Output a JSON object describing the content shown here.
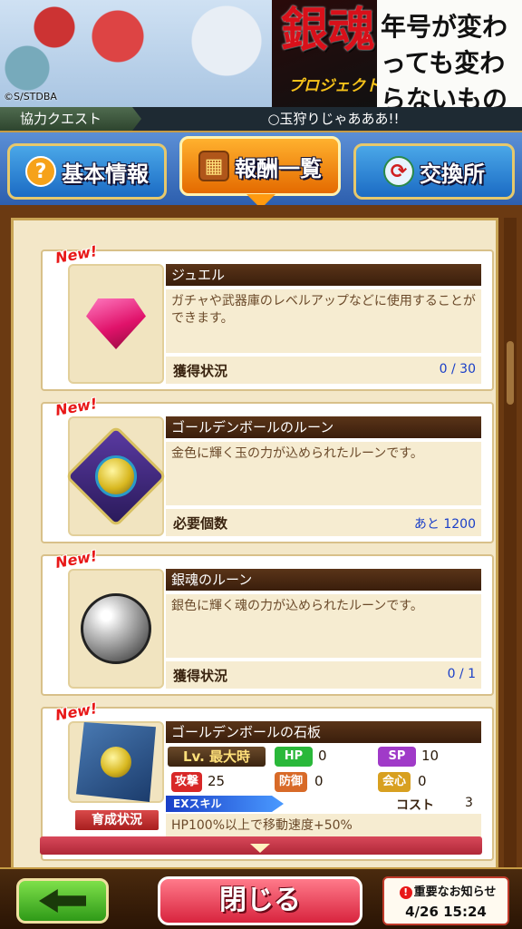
{
  "banner": {
    "logo": "銀魂",
    "logo_sub": "プロジェクト",
    "slogan": "年号が変わっても変わらないものがある",
    "copyright": "©S/STDBA"
  },
  "quest": {
    "type": "協力クエスト",
    "name": "○玉狩りじゃあああ!!"
  },
  "tabs": {
    "basic": {
      "label": "基本情報",
      "icon": "?"
    },
    "reward": {
      "label": "報酬一覧",
      "icon": "▦"
    },
    "exchange": {
      "label": "交換所",
      "icon": "⟳"
    }
  },
  "cards": [
    {
      "new": "New!",
      "title": "ジュエル",
      "desc": "ガチャや武器庫のレベルアップなどに使用することができます。",
      "status_label": "獲得状況",
      "status_value": "0 / 30"
    },
    {
      "new": "New!",
      "title": "ゴールデンボールのルーン",
      "desc": "金色に輝く玉の力が込められたルーンです。",
      "status_label": "必要個数",
      "status_value": "あと 1200"
    },
    {
      "new": "New!",
      "title": "銀魂のルーン",
      "desc": "銀色に輝く魂の力が込められたルーンです。",
      "status_label": "獲得状況",
      "status_value": "0 / 1"
    },
    {
      "new": "New!",
      "title": "ゴールデンボールの石板",
      "grow_label": "育成状況",
      "lv_label": "Lv. 最大時",
      "stats": {
        "hp_label": "HP",
        "hp_value": "0",
        "sp_label": "SP",
        "sp_value": "10",
        "atk_label": "攻撃",
        "atk_value": "25",
        "def_label": "防御",
        "def_value": "0",
        "crit_label": "会心",
        "crit_value": "0"
      },
      "ex_label": "EXスキル",
      "cost_label": "コスト",
      "cost_value": "3",
      "ex_desc": "HP100%以上で移動速度+50%"
    }
  ],
  "bottom": {
    "close_label": "閉じる",
    "notice_title": "重要なお知らせ",
    "notice_icon": "!",
    "notice_time": "4/26 15:24"
  },
  "colors": {
    "accent": "#ff9a10",
    "tab_blue": "#1b6bc4",
    "frame_brown": "#6b3a12",
    "close_red": "#d8243e",
    "back_green": "#2f9a18",
    "value_blue": "#1a3fc8"
  },
  "icons": [
    "question-icon",
    "treasure-chest-icon",
    "exchange-icon",
    "jewel-icon",
    "gold-rune-icon",
    "silver-rune-icon",
    "stone-tablet-icon",
    "back-arrow-icon"
  ]
}
